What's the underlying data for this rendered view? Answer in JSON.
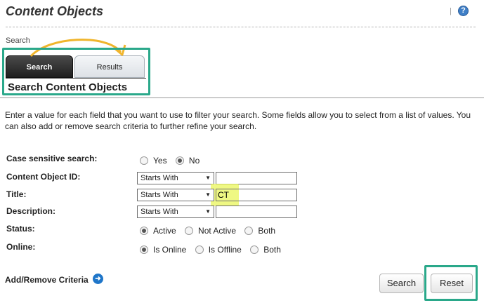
{
  "page": {
    "title": "Content Objects"
  },
  "header": {
    "separator": "|",
    "help_icon": "question-icon",
    "help_glyph": "?"
  },
  "breadcrumb": "Search",
  "tabs": [
    {
      "label": "Search",
      "active": true
    },
    {
      "label": "Results",
      "active": false
    }
  ],
  "section_title": "Search Content Objects",
  "intro": "Enter a value for each field that you want to use to filter your search. Some fields allow you to select from a list of values. You can also add or remove search criteria to further refine your search.",
  "form": {
    "case_sensitive": {
      "label": "Case sensitive search:",
      "options": [
        "Yes",
        "No"
      ],
      "selected": "No"
    },
    "content_object_id": {
      "label": "Content Object ID:",
      "operator": "Starts With",
      "value": ""
    },
    "title": {
      "label": "Title:",
      "operator": "Starts With",
      "value": "CT"
    },
    "description": {
      "label": "Description:",
      "operator": "Starts With",
      "value": ""
    },
    "status": {
      "label": "Status:",
      "options": [
        "Active",
        "Not Active",
        "Both"
      ],
      "selected": "Active"
    },
    "online": {
      "label": "Online:",
      "options": [
        "Is Online",
        "Is Offline",
        "Both"
      ],
      "selected": "Is Online"
    }
  },
  "add_remove": {
    "label": "Add/Remove Criteria",
    "icon": "arrow-right-circle-icon",
    "glyph": "➜"
  },
  "buttons": {
    "search": "Search",
    "reset": "Reset"
  },
  "icons": {
    "caret": "▼"
  },
  "colors": {
    "annotation_box": "#2aa88a",
    "annotation_arrow": "#f0b52c",
    "highlight": "#e9f55a",
    "active_tab": "#2b2b2b",
    "link_icon": "#1f76c9"
  }
}
